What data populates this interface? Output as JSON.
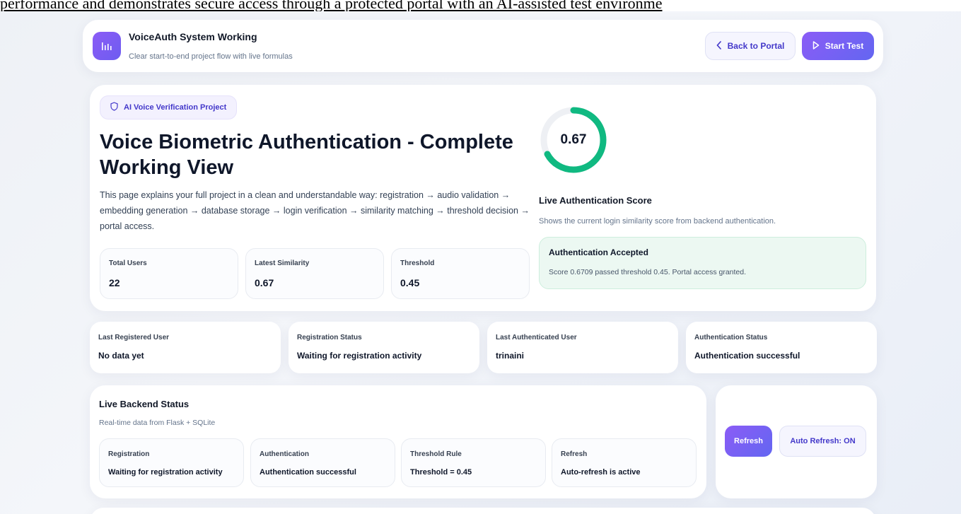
{
  "caption": "performance and demonstrates secure access through a protected portal with an AI-assisted test environme",
  "header": {
    "title": "VoiceAuth System Working",
    "subtitle": "Clear start-to-end project flow with live formulas",
    "back_label": "Back to Portal",
    "start_label": "Start Test",
    "logo_icon": "audio-bars-icon"
  },
  "hero": {
    "badge": "AI Voice Verification Project",
    "title": "Voice Biometric Authentication - Complete Working View",
    "description": "This page explains your full project in a clean and understandable way: registration → audio validation → embedding generation → database storage → login verification → similarity matching → threshold decision → portal access.",
    "stats": [
      {
        "label": "Total Users",
        "value": "22"
      },
      {
        "label": "Latest Similarity",
        "value": "0.67"
      },
      {
        "label": "Threshold",
        "value": "0.45"
      }
    ],
    "gauge": {
      "value_text": "0.67",
      "fraction": 0.67,
      "color": "#10b981",
      "track_color": "#eef0f4"
    },
    "score_title": "Live Authentication Score",
    "score_subtitle": "Shows the current login similarity score from backend authentication.",
    "result": {
      "title": "Authentication Accepted",
      "message": "Score 0.6709 passed threshold 0.45. Portal access granted."
    }
  },
  "info_cards": [
    {
      "label": "Last Registered User",
      "value": "No data yet"
    },
    {
      "label": "Registration Status",
      "value": "Waiting for registration activity"
    },
    {
      "label": "Last Authenticated User",
      "value": "trinaini"
    },
    {
      "label": "Authentication Status",
      "value": "Authentication successful"
    }
  ],
  "backend": {
    "title": "Live Backend Status",
    "subtitle": "Real-time data from Flask + SQLite",
    "items": [
      {
        "label": "Registration",
        "value": "Waiting for registration activity"
      },
      {
        "label": "Authentication",
        "value": "Authentication successful"
      },
      {
        "label": "Threshold Rule",
        "value": "Threshold = 0.45"
      },
      {
        "label": "Refresh",
        "value": "Auto-refresh is active"
      }
    ],
    "refresh_label": "Refresh",
    "auto_refresh_label": "Auto Refresh: ON"
  },
  "colors": {
    "accent": "#6d5cf0",
    "success": "#10b981"
  }
}
